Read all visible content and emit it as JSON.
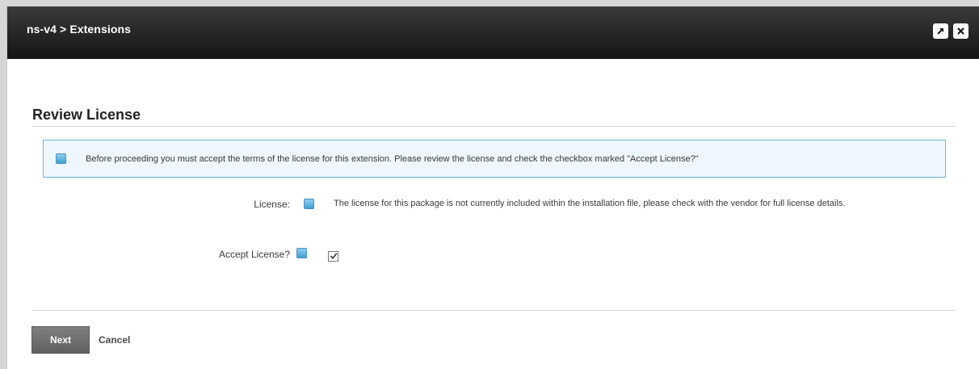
{
  "window": {
    "title": "ns-v4 > Extensions"
  },
  "section": {
    "title": "Review License"
  },
  "info": {
    "message": "Before proceeding you must accept the terms of the license for this extension. Please review the license and check the checkbox marked \"Accept License?\""
  },
  "license": {
    "label": "License:",
    "text": "The license for this package is not currently included within the installation file, please check with the vendor for full license details."
  },
  "accept": {
    "label": "Accept License?",
    "checked": true
  },
  "footer": {
    "next_label": "Next",
    "cancel_label": "Cancel"
  },
  "icons": {
    "popout": "popout-icon",
    "close": "close-icon",
    "help": "help-icon",
    "info": "info-icon",
    "check": "checkmark-icon"
  },
  "colors": {
    "titlebar": "#1f1f1f",
    "info_border": "#6fb6d6",
    "info_bg": "#eef7fb",
    "help_icon": "#4aa8dc",
    "primary_button": "#707070"
  }
}
